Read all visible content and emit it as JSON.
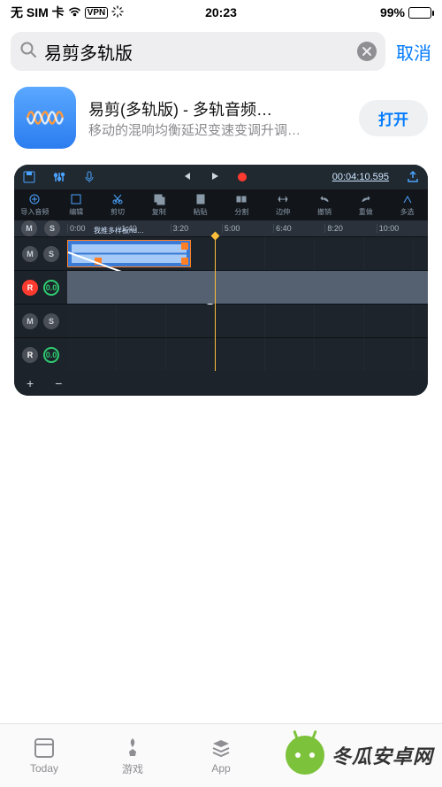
{
  "status": {
    "carrier": "无 SIM 卡",
    "vpn": "VPN",
    "time": "20:23",
    "battery_pct": "99%"
  },
  "search": {
    "query": "易剪多轨版",
    "cancel": "取消"
  },
  "app": {
    "title": "易剪(多轨版) - 多轨音频…",
    "subtitle": "移动的混响均衡延迟变速变调升调…",
    "open": "打开"
  },
  "shot": {
    "timecode": "00:04:10.595",
    "toolbar2": [
      {
        "icon": "plus-circle",
        "label": "导入音频"
      },
      {
        "icon": "crop",
        "label": "编辑"
      },
      {
        "icon": "cut",
        "label": "剪切"
      },
      {
        "icon": "copy",
        "label": "复制"
      },
      {
        "icon": "paste",
        "label": "粘贴"
      },
      {
        "icon": "split",
        "label": "分割"
      },
      {
        "icon": "stretch",
        "label": "边伸"
      },
      {
        "icon": "undo",
        "label": "撤销"
      },
      {
        "icon": "redo",
        "label": "重做"
      },
      {
        "icon": "multi",
        "label": "多选"
      }
    ],
    "ruler": [
      "0:00",
      "1:40",
      "3:20",
      "5:00",
      "6:40",
      "8:20",
      "10:00"
    ],
    "controls": {
      "m": "M",
      "s": "S",
      "r": "R",
      "g": "0.0"
    },
    "clip_title": "我推多样板nd…",
    "add": "+",
    "remove": "−"
  },
  "tabbar": [
    {
      "icon": "today",
      "label": "Today"
    },
    {
      "icon": "rocket",
      "label": "游戏"
    },
    {
      "icon": "stack",
      "label": "App"
    }
  ],
  "watermark": "冬瓜安卓网"
}
